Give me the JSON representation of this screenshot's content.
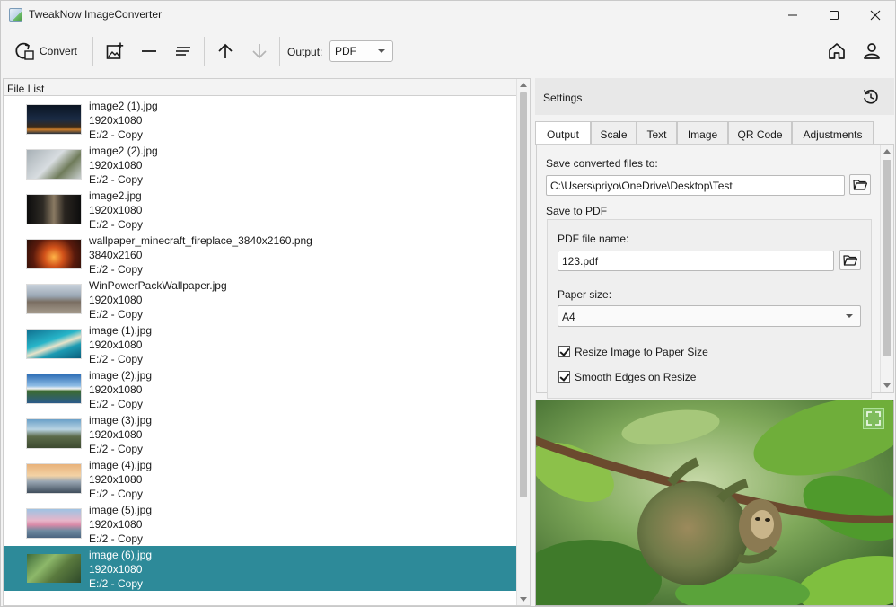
{
  "window": {
    "title": "TweakNow ImageConverter",
    "controls": {
      "minimize": "minimize-icon",
      "maximize": "maximize-icon",
      "close": "close-icon"
    }
  },
  "toolbar": {
    "convert_label": "Convert",
    "output_label": "Output:",
    "output_value": "PDF",
    "icons": [
      "convert-icon",
      "add-image-icon",
      "remove-icon",
      "clear-list-icon",
      "move-up-icon",
      "move-down-icon",
      "home-icon",
      "user-icon"
    ]
  },
  "filelist": {
    "header": "File List",
    "items": [
      {
        "name": "image2 (1).jpg",
        "dims": "1920x1080",
        "path": "E:/2 - Copy",
        "selected": false
      },
      {
        "name": "image2 (2).jpg",
        "dims": "1920x1080",
        "path": "E:/2 - Copy",
        "selected": false
      },
      {
        "name": "image2.jpg",
        "dims": "1920x1080",
        "path": "E:/2 - Copy",
        "selected": false
      },
      {
        "name": "wallpaper_minecraft_fireplace_3840x2160.png",
        "dims": "3840x2160",
        "path": "E:/2 - Copy",
        "selected": false
      },
      {
        "name": "WinPowerPackWallpaper.jpg",
        "dims": "1920x1080",
        "path": "E:/2 - Copy",
        "selected": false
      },
      {
        "name": "image (1).jpg",
        "dims": "1920x1080",
        "path": "E:/2 - Copy",
        "selected": false
      },
      {
        "name": "image (2).jpg",
        "dims": "1920x1080",
        "path": "E:/2 - Copy",
        "selected": false
      },
      {
        "name": "image (3).jpg",
        "dims": "1920x1080",
        "path": "E:/2 - Copy",
        "selected": false
      },
      {
        "name": "image (4).jpg",
        "dims": "1920x1080",
        "path": "E:/2 - Copy",
        "selected": false
      },
      {
        "name": "image (5).jpg",
        "dims": "1920x1080",
        "path": "E:/2 - Copy",
        "selected": false
      },
      {
        "name": "image (6).jpg",
        "dims": "1920x1080",
        "path": "E:/2 - Copy",
        "selected": true
      }
    ]
  },
  "settings": {
    "title": "Settings",
    "tabs": [
      "Output",
      "Scale",
      "Text",
      "Image",
      "QR Code",
      "Adjustments"
    ],
    "active_tab": "Output",
    "save_to_label": "Save converted files to:",
    "save_to_value": "C:\\Users\\priyo\\OneDrive\\Desktop\\Test",
    "save_pdf_label": "Save to PDF",
    "pdf_name_label": "PDF file name:",
    "pdf_name_value": "123.pdf",
    "paper_size_label": "Paper size:",
    "paper_size_value": "A4",
    "resize_label": "Resize Image to Paper Size",
    "resize_checked": true,
    "smooth_label": "Smooth Edges on Resize",
    "smooth_checked": true
  },
  "colors": {
    "selection": "#2d8a99",
    "window_bg": "#f3f3f3"
  }
}
